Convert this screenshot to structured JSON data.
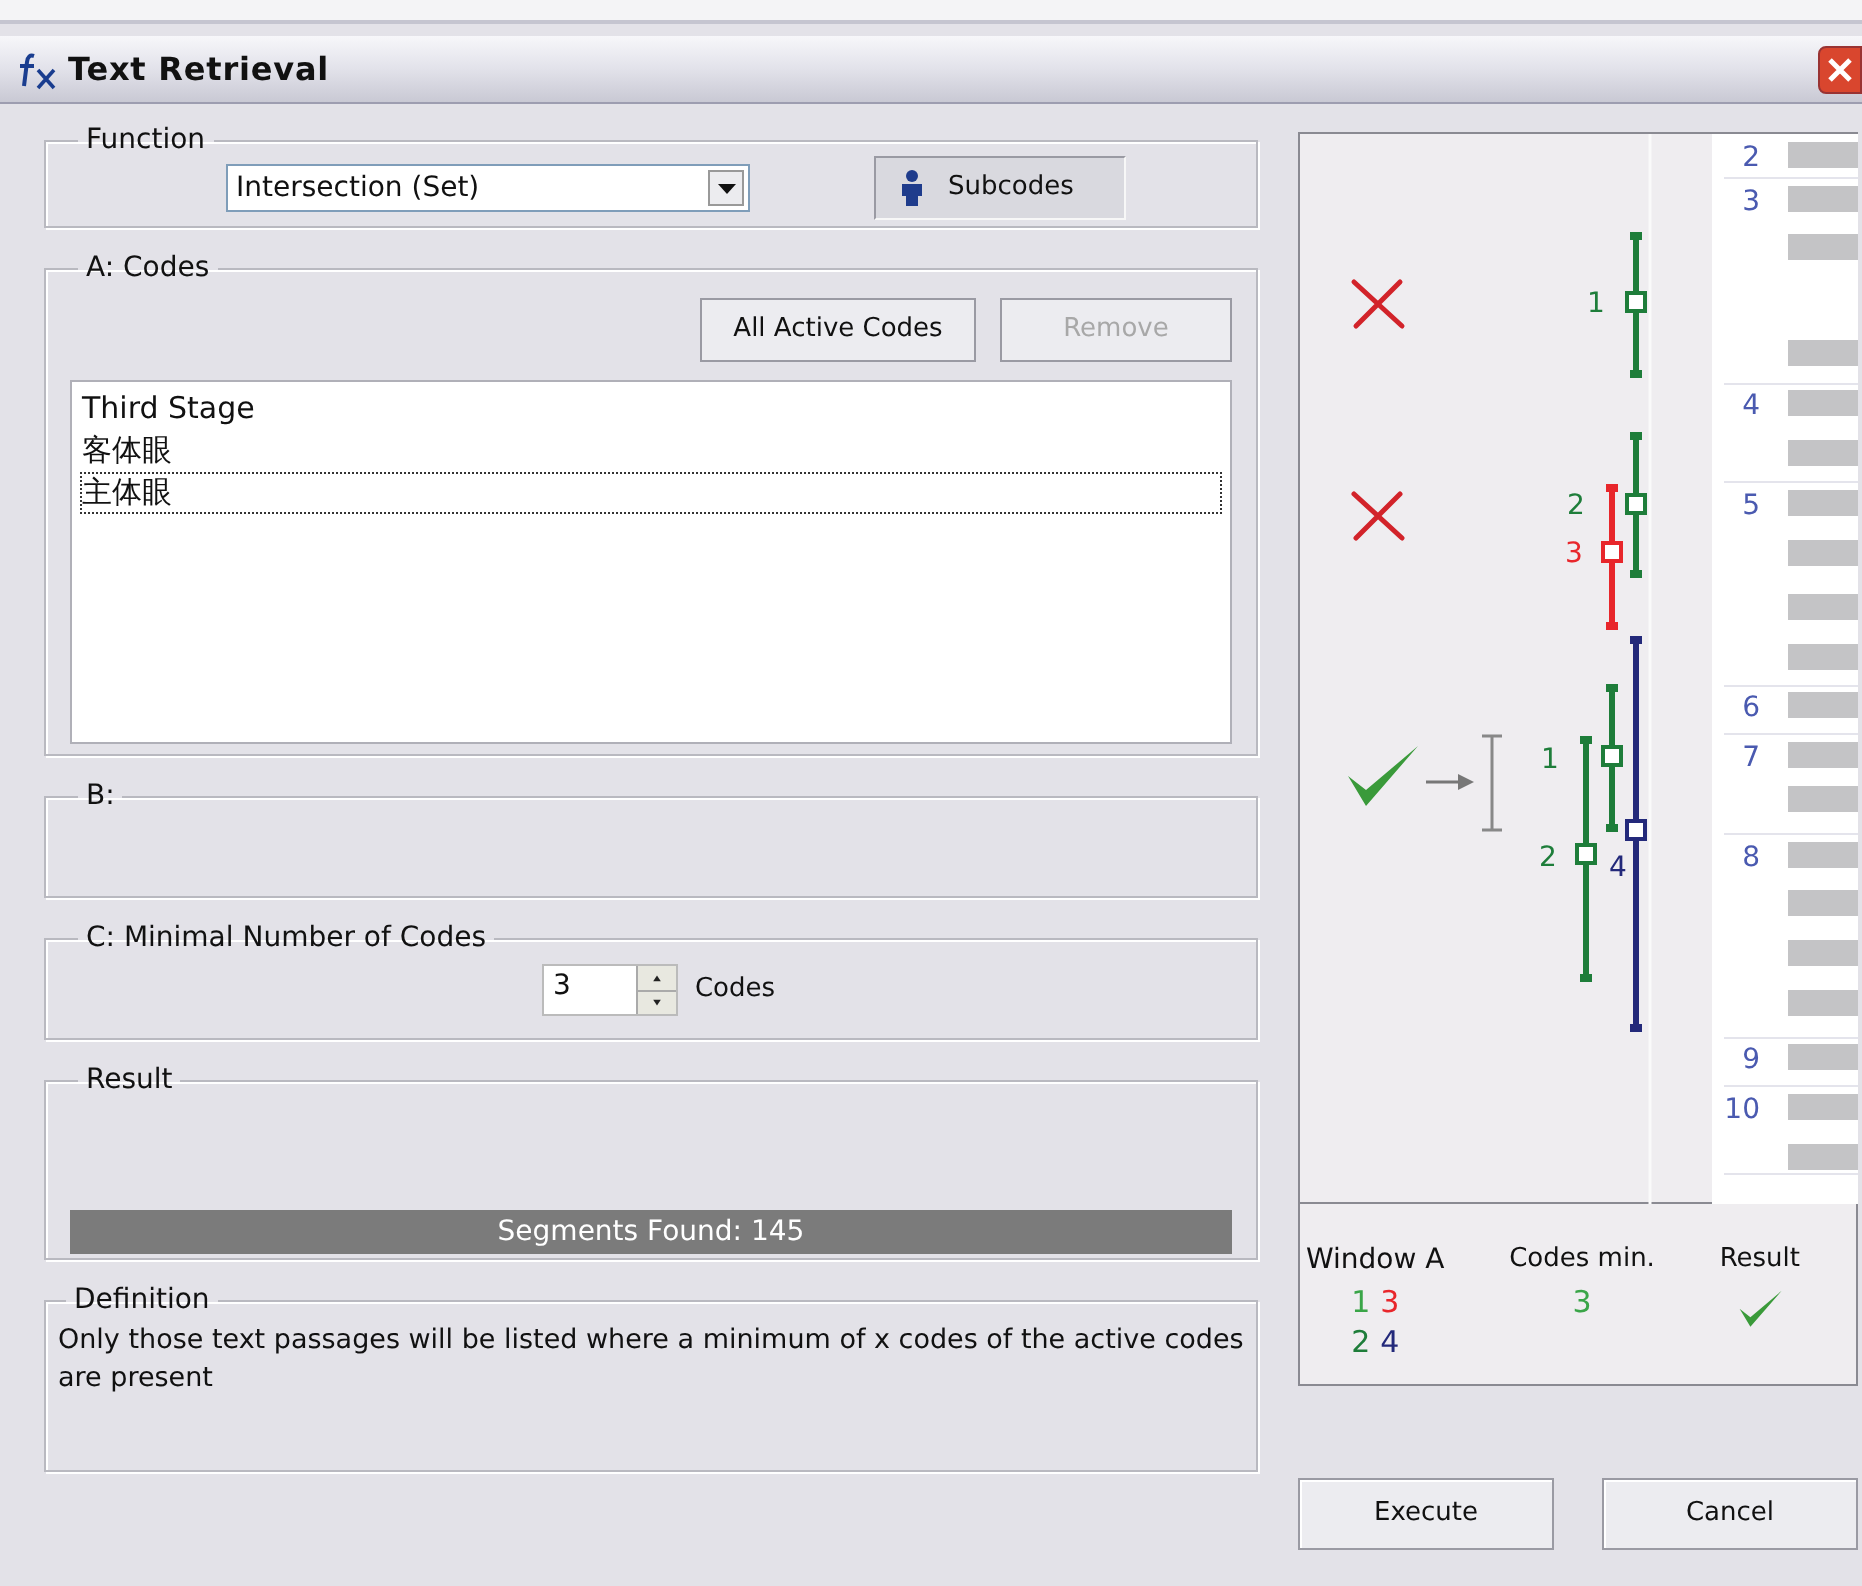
{
  "window": {
    "title": "Text Retrieval"
  },
  "function": {
    "label": "Function",
    "value": "Intersection (Set)",
    "subcodes": {
      "label": "Subcodes",
      "selected": true
    }
  },
  "codes": {
    "label": "A: Codes",
    "buttons": [
      {
        "label": "All Active Codes",
        "disabled": false
      },
      {
        "label": "Remove",
        "disabled": true
      }
    ],
    "items": [
      {
        "label": "Third Stage",
        "selected": false
      },
      {
        "label": "客体眼",
        "selected": false
      },
      {
        "label": "主体眼",
        "selected": true
      }
    ]
  },
  "b": {
    "label": "B:"
  },
  "minimal": {
    "label": "C: Minimal Number of Codes",
    "value": "3",
    "unit": "Codes"
  },
  "result": {
    "label": "Result",
    "text": "Segments Found: 145",
    "level": 1
  },
  "definition": {
    "label": "Definition",
    "text": "Only those text passages will be listed where a minimum of x codes of the active codes are present"
  },
  "illustration": {
    "examples": [
      {
        "kind": "fail",
        "segments": [
          {
            "label": "1",
            "color": "#1e7d3a"
          }
        ]
      },
      {
        "kind": "fail",
        "segments": [
          {
            "label": "2",
            "color": "#1e7d3a"
          },
          {
            "label": "3",
            "color": "#e8262b"
          }
        ]
      },
      {
        "kind": "pass",
        "segments": [
          {
            "label": "1",
            "color": "#1e7d3a"
          },
          {
            "label": "2",
            "color": "#1e7d3a"
          },
          {
            "label": "4",
            "color": "#23297a"
          }
        ]
      }
    ],
    "line_numbers": [
      "2",
      "3",
      "4",
      "5",
      "6",
      "7",
      "8",
      "9",
      "10"
    ]
  },
  "legend": {
    "window_label": "Window A",
    "codes": [
      {
        "label": "1",
        "color": "#3aa548"
      },
      {
        "label": "3",
        "color": "#e8262b"
      },
      {
        "label": "2",
        "color": "#1e7d3a"
      },
      {
        "label": "4",
        "color": "#23297a"
      }
    ],
    "codes_min_label": "Codes min.",
    "codes_min_value": "3",
    "result_label": "Result",
    "result": {
      "kind": "pass"
    }
  },
  "buttons": [
    {
      "label": "Execute"
    },
    {
      "label": "Cancel"
    }
  ]
}
